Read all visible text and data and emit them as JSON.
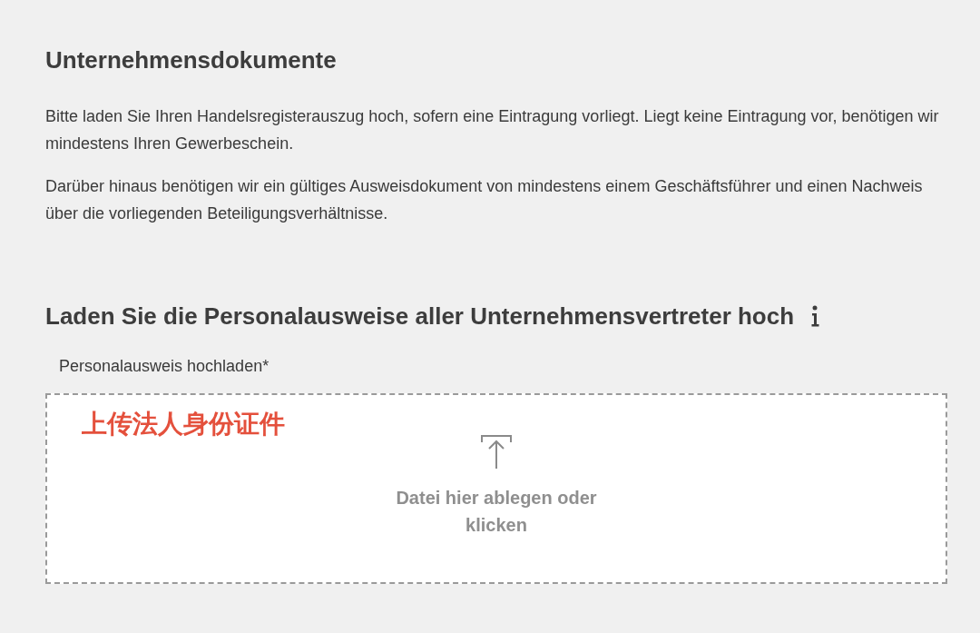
{
  "section": {
    "title": "Unternehmensdokumente",
    "paragraphs": [
      "Bitte laden Sie Ihren Handelsregisterauszug hoch, sofern eine Eintragung vorliegt. Liegt keine Eintragung vor, benötigen wir mindestens Ihren Gewerbeschein.",
      "Darüber hinaus benötigen wir ein gültiges Ausweisdokument von mindestens einem Geschäftsführer und einen Nachweis über die vorliegenden Beteiligungsverhältnisse."
    ]
  },
  "upload": {
    "title": "Laden Sie die Personalausweise aller Unternehmensvertreter hoch",
    "label": "Personalausweis hochladen*",
    "annotation": "上传法人身份证件",
    "dropzone_text": "Datei hier ablegen oder klicken"
  }
}
